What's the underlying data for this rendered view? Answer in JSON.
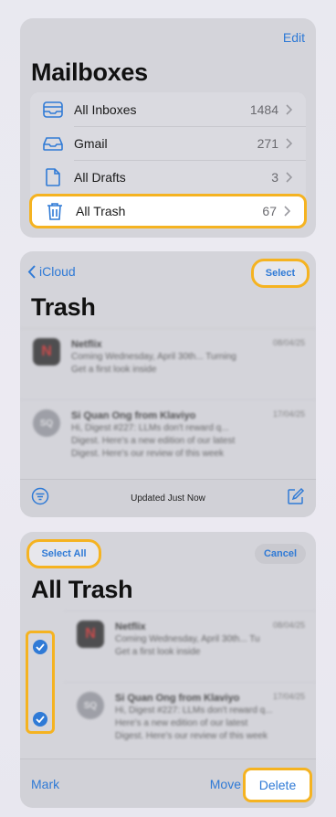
{
  "mailboxes": {
    "edit": "Edit",
    "title": "Mailboxes",
    "items": [
      {
        "label": "All Inboxes",
        "count": "1484",
        "icon": "tray-icon"
      },
      {
        "label": "Gmail",
        "count": "271",
        "icon": "inbox-icon"
      },
      {
        "label": "All Drafts",
        "count": "3",
        "icon": "document-icon"
      },
      {
        "label": "All Trash",
        "count": "67",
        "icon": "trash-icon"
      }
    ]
  },
  "trash": {
    "back": "iCloud",
    "select": "Select",
    "title": "Trash",
    "messages": [
      {
        "sender": "Netflix",
        "date": "08/04/25",
        "line1": "Coming Wednesday, April 30th... Turning",
        "line2": "Get a first look inside",
        "avatar": "N"
      },
      {
        "sender": "Si Quan Ong from Klaviyo",
        "date": "17/04/25",
        "line1": "Hi, Digest #227: LLMs don't reward q...",
        "line2": "Digest. Here's a new edition of our latest",
        "line3": "Digest. Here's our review of this week",
        "avatar": "SQ"
      }
    ],
    "status": "Updated Just Now"
  },
  "all_trash": {
    "select_all": "Select All",
    "cancel": "Cancel",
    "title": "All Trash",
    "messages": [
      {
        "sender": "Netflix",
        "date": "08/04/25",
        "line1": "Coming Wednesday, April 30th... Tu",
        "line2": "Get a first look inside",
        "avatar": "N"
      },
      {
        "sender": "Si Quan Ong from Klaviyo",
        "date": "17/04/25",
        "line1": "Hi, Digest #227: LLMs don't reward q...",
        "line2": "Here's a new edition of our latest",
        "line3": "Digest. Here's our review of this week",
        "avatar": "SQ"
      }
    ],
    "toolbar": {
      "mark": "Mark",
      "move": "Move",
      "delete": "Delete"
    }
  },
  "colors": {
    "accent": "#2f7ad6",
    "highlight": "#f5b321"
  }
}
